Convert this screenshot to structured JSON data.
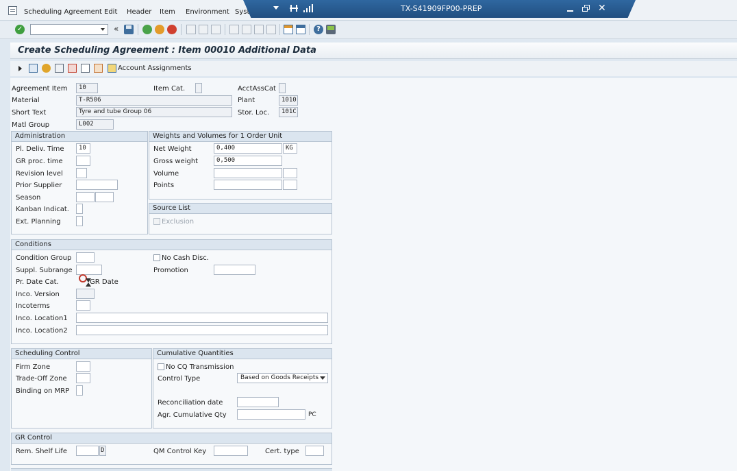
{
  "menu": {
    "items": [
      "Scheduling Agreement",
      "Edit",
      "Header",
      "Item",
      "Environment",
      "Syste"
    ]
  },
  "titlebar": {
    "system": "TX-S41909FP00-PREP"
  },
  "page": {
    "title": "Create Scheduling Agreement : Item 00010 Additional Data"
  },
  "app_toolbar": {
    "account_assignments": "Account Assignments"
  },
  "header": {
    "agreement_item_label": "Agreement Item",
    "agreement_item": "10",
    "item_cat_label": "Item Cat.",
    "acctasscat_label": "AcctAssCat",
    "material_label": "Material",
    "material": "T-R506",
    "plant_label": "Plant",
    "plant": "1010",
    "short_text_label": "Short Text",
    "short_text": "Tyre and tube Group 06",
    "stor_loc_label": "Stor. Loc.",
    "stor_loc": "101C",
    "matl_group_label": "Matl Group",
    "matl_group": "L002"
  },
  "administration": {
    "title": "Administration",
    "pl_deliv_time_label": "Pl. Deliv. Time",
    "pl_deliv_time": "10",
    "gr_proc_time_label": "GR proc. time",
    "revision_level_label": "Revision level",
    "prior_supplier_label": "Prior Supplier",
    "season_label": "Season",
    "kanban_label": "Kanban Indicat.",
    "ext_planning_label": "Ext. Planning"
  },
  "weights": {
    "title": "Weights and Volumes for 1 Order Unit",
    "net_weight_label": "Net Weight",
    "net_weight": "0,400",
    "net_weight_unit": "KG",
    "gross_weight_label": "Gross weight",
    "gross_weight": "0,500",
    "volume_label": "Volume",
    "points_label": "Points"
  },
  "source_list": {
    "title": "Source List",
    "exclusion_label": "Exclusion"
  },
  "conditions": {
    "title": "Conditions",
    "condition_group_label": "Condition Group",
    "no_cash_disc_label": "No Cash Disc.",
    "suppl_subrange_label": "Suppl. Subrange",
    "promotion_label": "Promotion",
    "pr_date_cat_label": "Pr. Date Cat.",
    "pr_date_cat_value": "GR Date",
    "inco_version_label": "Inco. Version",
    "incoterms_label": "Incoterms",
    "inco_location1_label": "Inco. Location1",
    "inco_location2_label": "Inco. Location2"
  },
  "scheduling_control": {
    "title": "Scheduling Control",
    "firm_zone_label": "Firm Zone",
    "trade_off_zone_label": "Trade-Off Zone",
    "binding_mrp_label": "Binding on MRP"
  },
  "cumulative": {
    "title": "Cumulative Quantities",
    "no_cq_label": "No CQ Transmission",
    "control_type_label": "Control Type",
    "control_type": "Based on Goods Receipts",
    "reconciliation_label": "Reconciliation date",
    "agr_cum_qty_label": "Agr. Cumulative Qty",
    "agr_cum_qty_unit": "PC"
  },
  "gr_control": {
    "title": "GR Control",
    "rem_shelf_life_label": "Rem. Shelf Life",
    "rem_shelf_life_unit": "D",
    "qm_control_key_label": "QM Control Key",
    "cert_type_label": "Cert. type"
  },
  "colors": {
    "titlebar": "#2a5d92",
    "body": "#dfe8f1",
    "group_header": "#dbe5ef"
  }
}
